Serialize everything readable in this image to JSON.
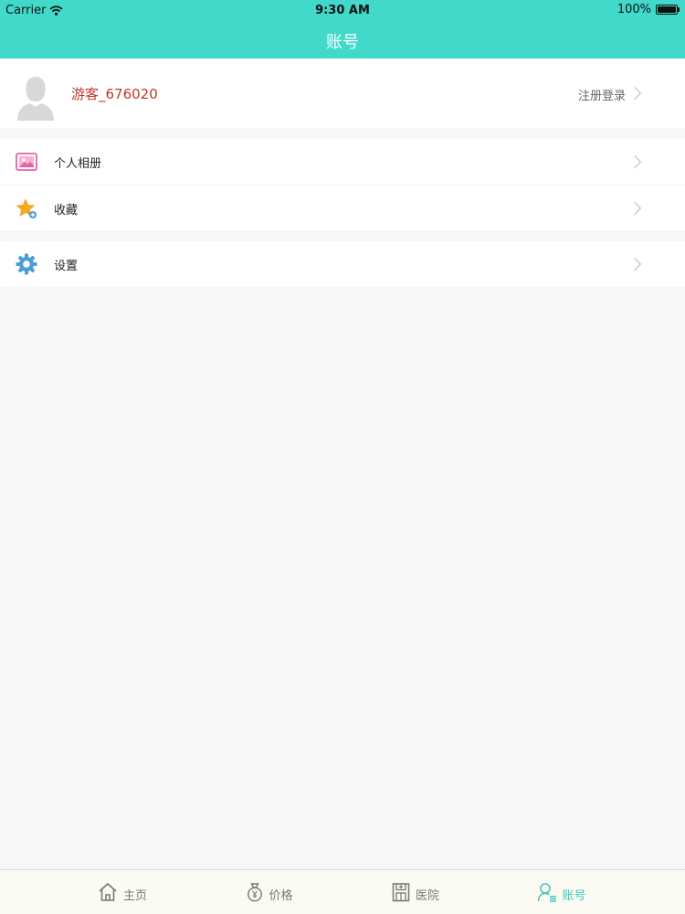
{
  "status_bar": {
    "carrier": "Carrier",
    "time": "9:30 AM",
    "battery": "100%"
  },
  "header": {
    "title": "账号"
  },
  "profile": {
    "username": "游客_676020",
    "login_label": "注册登录"
  },
  "menu": {
    "album_label": "个人相册",
    "favorites_label": "收藏",
    "settings_label": "设置"
  },
  "tabbar": {
    "tabs": [
      {
        "label": "主页",
        "icon": "home-icon"
      },
      {
        "label": "价格",
        "icon": "money-bag-icon"
      },
      {
        "label": "医院",
        "icon": "hospital-icon"
      },
      {
        "label": "账号",
        "icon": "account-icon"
      }
    ],
    "active_index": 3
  },
  "colors": {
    "header": "#40d9ca",
    "username": "#c0392b",
    "active_tab": "#3dc5be"
  }
}
